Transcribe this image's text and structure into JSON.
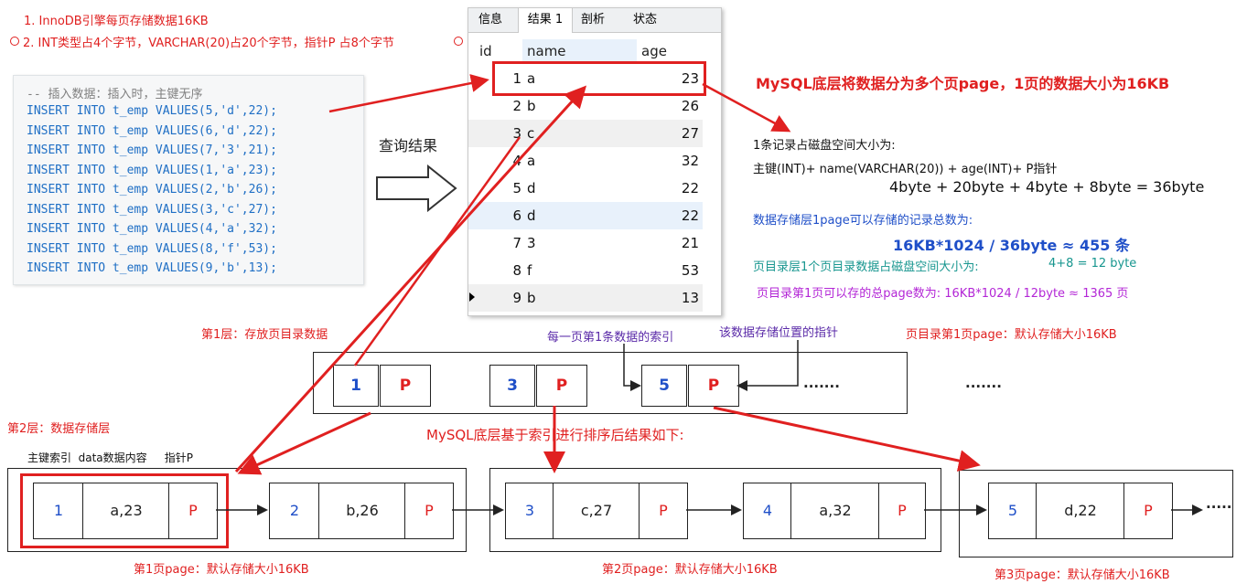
{
  "notes": {
    "note1": "1. InnoDB引擎每页存储数据16KB",
    "note2": "2. INT类型占4个字节，VARCHAR(20)占20个字节，指针P 占8个字节"
  },
  "code": {
    "comment": "-- 插入数据：插入时，主键无序",
    "lines": [
      "INSERT INTO t_emp VALUES(5,'d',22);",
      "INSERT INTO t_emp VALUES(6,'d',22);",
      "INSERT INTO t_emp VALUES(7,'3',21);",
      "INSERT INTO t_emp VALUES(1,'a',23);",
      "INSERT INTO t_emp VALUES(2,'b',26);",
      "INSERT INTO t_emp VALUES(3,'c',27);",
      "INSERT INTO t_emp VALUES(4,'a',32);",
      "INSERT INTO t_emp VALUES(8,'f',53);",
      "INSERT INTO t_emp VALUES(9,'b',13);"
    ]
  },
  "query_label": "查询结果",
  "grid": {
    "tabs": [
      "信息",
      "结果 1",
      "剖析",
      "状态"
    ],
    "active_tab": "结果 1",
    "columns": [
      "id",
      "name",
      "age"
    ],
    "rows": [
      {
        "id": "1",
        "name": "a",
        "age": "23"
      },
      {
        "id": "2",
        "name": "b",
        "age": "26"
      },
      {
        "id": "3",
        "name": "c",
        "age": "27"
      },
      {
        "id": "4",
        "name": "a",
        "age": "32"
      },
      {
        "id": "5",
        "name": "d",
        "age": "22"
      },
      {
        "id": "6",
        "name": "d",
        "age": "22"
      },
      {
        "id": "7",
        "name": "3",
        "age": "21"
      },
      {
        "id": "8",
        "name": "f",
        "age": "53"
      },
      {
        "id": "9",
        "name": "b",
        "age": "13"
      }
    ]
  },
  "right_notes": {
    "title": "MySQL底层将数据分为多个页page，1页的数据大小为16KB",
    "record_size_label": "1条记录占磁盘空间大小为:",
    "record_formula": "主键(INT)+ name(VARCHAR(20)) + age(INT)+ P指针",
    "record_result": "4byte + 20byte + 4byte + 8byte = 36byte",
    "data_layer_label": "数据存储层1page可以存储的记录总数为:",
    "data_layer_result": "16KB*1024 / 36byte ≈ 455 条",
    "dir_record_label": "页目录层1个页目录数据占磁盘空间大小为:",
    "dir_record_result": "4+8 = 12 byte",
    "dir_page_label": "页目录第1页可以存的总page数为: 16KB*1024 / 12byte  ≈ 1365 页"
  },
  "index_layer": {
    "layer_label": "第1层：存放页目录数据",
    "index_label": "每一页第1条数据的索引",
    "pointer_label": "该数据存储位置的指针",
    "page_label": "页目录第1页page：默认存储大小16KB",
    "entries": [
      {
        "key": "1",
        "ptr": "P"
      },
      {
        "key": "3",
        "ptr": "P"
      },
      {
        "key": "5",
        "ptr": "P"
      }
    ],
    "ellipsis1": "·······",
    "ellipsis2": "·······"
  },
  "data_layer": {
    "layer_label": "第2层：数据存储层",
    "sorted_label": "MySQL底层基于索引进行排序后结果如下:",
    "field_labels": "主键索引  data数据内容     指针P",
    "pages": [
      {
        "label": "第1页page：默认存储大小16KB",
        "records": [
          {
            "key": "1",
            "data": "a,23",
            "ptr": "P"
          },
          {
            "key": "2",
            "data": "b,26",
            "ptr": "P"
          }
        ]
      },
      {
        "label": "第2页page：默认存储大小16KB",
        "records": [
          {
            "key": "3",
            "data": "c,27",
            "ptr": "P"
          },
          {
            "key": "4",
            "data": "a,32",
            "ptr": "P"
          }
        ]
      },
      {
        "label": "第3页page：默认存储大小16KB",
        "records": [
          {
            "key": "5",
            "data": "d,22",
            "ptr": "P"
          }
        ]
      }
    ],
    "ellipsis": "·····"
  },
  "colors": {
    "accent_red": "#e02020",
    "blue_text": "#1f4fc8",
    "teal_text": "#17968f",
    "purple_text": "#b326d6",
    "purple_label": "#5a2aa8"
  }
}
